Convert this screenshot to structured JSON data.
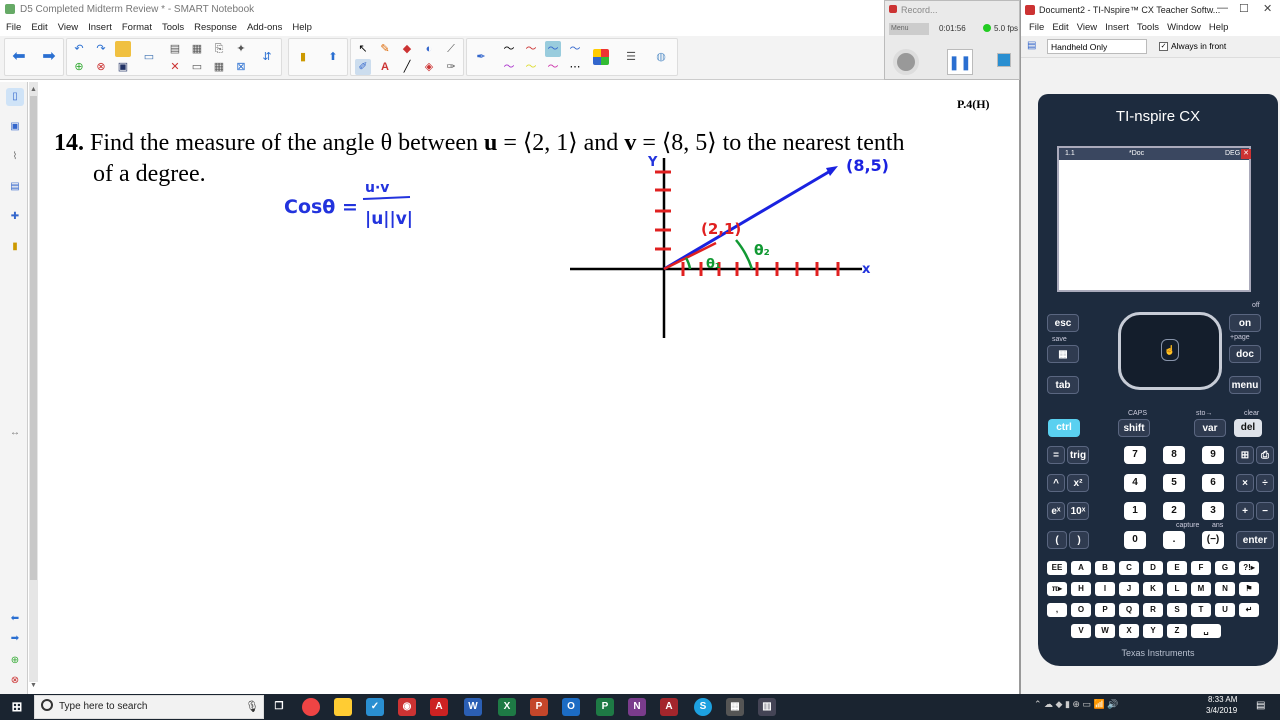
{
  "smart_notebook": {
    "title": "D5 Completed Midterm Review * - SMART Notebook",
    "menu": [
      "File",
      "Edit",
      "View",
      "Insert",
      "Format",
      "Tools",
      "Response",
      "Add-ons",
      "Help"
    ],
    "page_code": "P.4(H)",
    "problem": {
      "number": "14.",
      "line1_a": "Find the measure of the angle θ between ",
      "u": "u",
      "line1_b": " = ⟨2, 1⟩ and ",
      "v": "v",
      "line1_c": " = ⟨8, 5⟩ to the nearest tenth",
      "line2": "of a degree."
    },
    "ink": {
      "cos_formula": "Cosθ =",
      "numerator": "u·v",
      "denominator": "|u||v|",
      "axis_y": "Y",
      "axis_x": "x",
      "point_v": "(8,5)",
      "point_u": "(2,1)",
      "theta1": "θ₁",
      "theta2": "θ₂"
    }
  },
  "recorder": {
    "title": "Record...",
    "time": "0:01:56",
    "rate": "5.0 fps",
    "menu_label": "Menu"
  },
  "ti_nspire": {
    "title": "Document2 - TI-Nspire™ CX Teacher Softw...",
    "menu": [
      "File",
      "Edit",
      "View",
      "Insert",
      "Tools",
      "Window",
      "Help"
    ],
    "handheld_select": "Handheld Only",
    "always_front_label": "Always in front",
    "brand": "TI-nspire CX",
    "screen_tab": "1.1",
    "screen_doc": "*Doc",
    "screen_mode": "DEG",
    "keys": {
      "esc": "esc",
      "on": "on",
      "doc": "doc",
      "tab": "tab",
      "menu": "menu",
      "ctrl": "ctrl",
      "shift": "shift",
      "var": "var",
      "del": "del",
      "eq": "=",
      "trig": "trig",
      "n7": "7",
      "n8": "8",
      "n9": "9",
      "caret": "^",
      "x2": "x²",
      "n4": "4",
      "n5": "5",
      "n6": "6",
      "times": "×",
      "div": "÷",
      "ex": "eˣ",
      "tenx": "10ˣ",
      "n1": "1",
      "n2": "2",
      "n3": "3",
      "plus": "+",
      "minus": "−",
      "lparen": "(",
      "rparen": ")",
      "n0": "0",
      "dot": ".",
      "neg": "(−)",
      "enter": "enter",
      "letters": [
        "EE",
        "A",
        "B",
        "C",
        "D",
        "E",
        "F",
        "G",
        "?!▸",
        "π▸",
        "H",
        "I",
        "J",
        "K",
        "L",
        "M",
        "N",
        "⚑",
        ",",
        "O",
        "P",
        "Q",
        "R",
        "S",
        "T",
        "U",
        "↵",
        "V",
        "W",
        "X",
        "Y",
        "Z",
        "␣"
      ],
      "labels_top": [
        "save",
        "CAPS",
        "sto→",
        "clear",
        "off",
        "+page",
        "capture",
        "ans"
      ]
    },
    "logo": "Texas Instruments"
  },
  "taskbar": {
    "search_placeholder": "Type here to search",
    "time": "8:33 AM",
    "date": "3/4/2019"
  }
}
